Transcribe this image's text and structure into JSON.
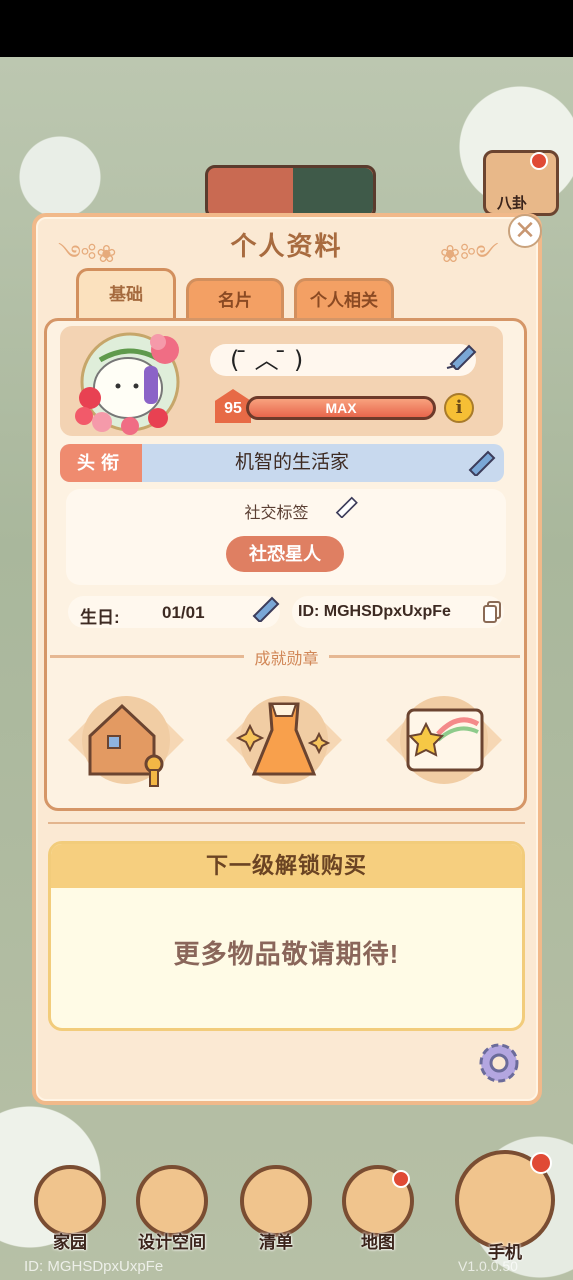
{
  "header": {
    "title": "个人资料"
  },
  "tabs": [
    {
      "label": "基础",
      "active": true
    },
    {
      "label": "名片",
      "active": false
    },
    {
      "label": "个人相关",
      "active": false
    }
  ],
  "profile": {
    "name": "(  ̄ ︿ ̄  )",
    "level": "95",
    "level_bar_text": "MAX",
    "level_progress": 1.0,
    "title_tag": "头衔",
    "title_value": "机智的生活家",
    "social_label": "社交标签",
    "social_tag": "社恐星人",
    "birthday_label": "生日:",
    "birthday_value": "01/01",
    "id_text": "ID: MGHSDpxUxpFe"
  },
  "achievements": {
    "label": "成就勋章",
    "medals": [
      {
        "icon": "house-key-icon"
      },
      {
        "icon": "dress-icon"
      },
      {
        "icon": "star-scroll-icon"
      }
    ]
  },
  "unlock": {
    "title": "下一级解锁购买",
    "message": "更多物品敬请期待!"
  },
  "bottom_nav": [
    {
      "label": "家园",
      "icon": "home-icon"
    },
    {
      "label": "设计空间",
      "icon": "design-icon"
    },
    {
      "label": "清单",
      "icon": "checklist-icon"
    },
    {
      "label": "地图",
      "icon": "map-icon"
    },
    {
      "label": "手机",
      "icon": "phone-icon"
    }
  ],
  "footer": {
    "id": "ID:  MGHSDpxUxpFe",
    "version": "V1.0.0.50"
  },
  "corner_button": {
    "label": "八卦"
  },
  "colors": {
    "accent": "#e76a46",
    "panel": "#fbe9d3",
    "border": "#d59667",
    "title_bg": "#c8d9ee"
  }
}
